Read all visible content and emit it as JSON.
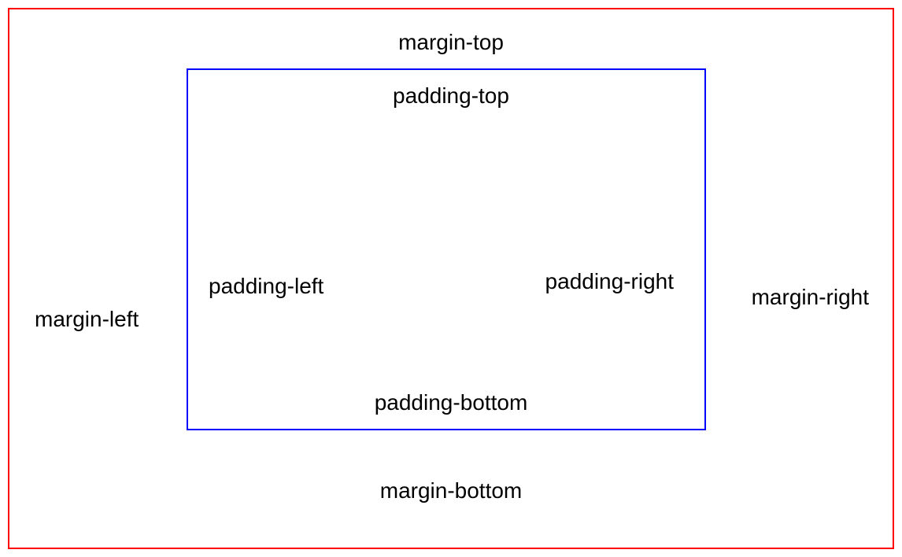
{
  "diagram": {
    "margin_top": "margin-top",
    "margin_bottom": "margin-bottom",
    "margin_left": "margin-left",
    "margin_right": "margin-right",
    "padding_top": "padding-top",
    "padding_bottom": "padding-bottom",
    "padding_left": "padding-left",
    "padding_right": "padding-right"
  },
  "colors": {
    "outer_border": "#ff0000",
    "inner_border": "#0000ff"
  }
}
